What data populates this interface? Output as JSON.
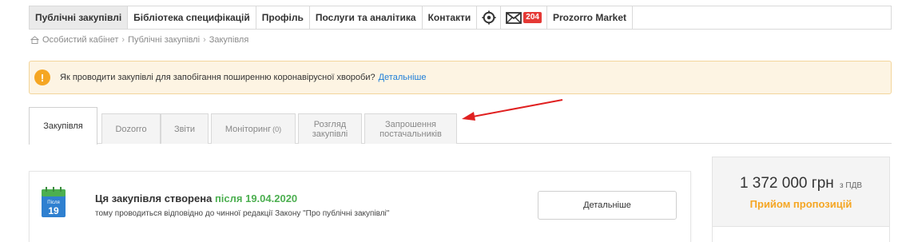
{
  "nav": {
    "items": [
      "Публічні закупівлі",
      "Бібліотека специфікацій",
      "Профіль",
      "Послуги та аналітика",
      "Контакти"
    ],
    "settings_icon": "gear-icon",
    "mail_icon": "mail-icon",
    "mail_count": "204",
    "market": "Prozorro Market"
  },
  "breadcrumb": {
    "home_icon": "home-icon",
    "items": [
      "Особистий кабінет",
      "Публічні закупівлі",
      "Закупівля"
    ],
    "separator": "›"
  },
  "alert": {
    "icon": "exclamation-icon",
    "text": "Як проводити закупівлі для запобігання поширенню коронавірусної хвороби?",
    "link": "Детальніше"
  },
  "tabs": [
    {
      "label": "Закупівля"
    },
    {
      "label": "Dozorro"
    },
    {
      "label": "Звіти"
    },
    {
      "label": "Моніторинг",
      "count": "(0)"
    },
    {
      "label_line1": "Розгляд",
      "label_line2": "закупівлі"
    },
    {
      "label_line1": "Запрошення",
      "label_line2": "постачальників"
    }
  ],
  "notice": {
    "calendar_month": "Після",
    "calendar_day": "19",
    "title": "Ця закупівля створена",
    "title_highlight": "після 19.04.2020",
    "subtitle": "тому проводиться відповідно до чинної редакції Закону \"Про публічні закупівлі\"",
    "button": "Детальніше"
  },
  "price": {
    "amount": "1 372 000 грн",
    "vat": "з ПДВ",
    "status": "Прийом пропозицій"
  },
  "colors": {
    "accent_orange": "#f5a623",
    "link_blue": "#1e7ed8",
    "badge_red": "#e53935",
    "highlight_green": "#4caf50",
    "arrow_red": "#e02020"
  }
}
